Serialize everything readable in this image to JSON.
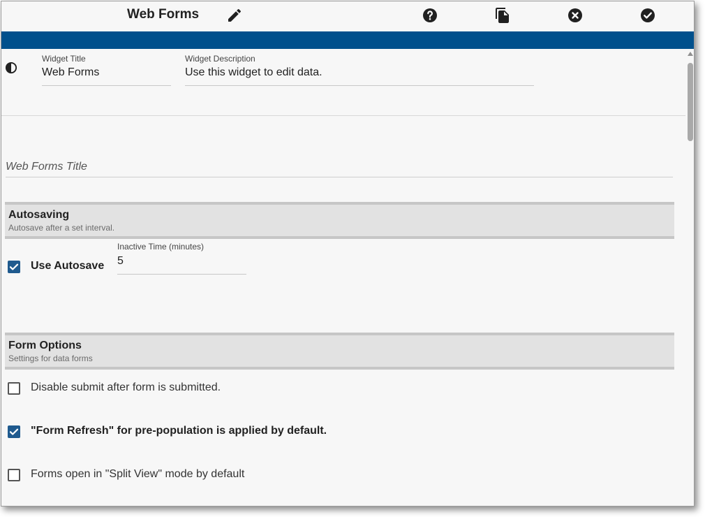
{
  "header": {
    "title": "Web Forms",
    "icons": [
      "pencil-icon",
      "help-icon",
      "copy-icon",
      "cancel-icon",
      "confirm-icon"
    ],
    "accent_color": "#00508c"
  },
  "widget": {
    "title_label": "Widget Title",
    "title_value": "Web Forms",
    "description_label": "Widget Description",
    "description_value": "Use this widget to edit data."
  },
  "web_forms_title": {
    "placeholder": "Web Forms Title"
  },
  "autosaving": {
    "title": "Autosaving",
    "subtitle": "Autosave after a set interval.",
    "use_autosave_label": "Use Autosave",
    "use_autosave_checked": true,
    "inactive_time_label": "Inactive Time (minutes)",
    "inactive_time_value": "5"
  },
  "form_options": {
    "title": "Form Options",
    "subtitle": "Settings for data forms",
    "options": [
      {
        "label": "Disable submit after form is submitted.",
        "checked": false
      },
      {
        "label": "\"Form Refresh\" for pre-population is applied by default.",
        "checked": true
      },
      {
        "label": "Forms open in \"Split View\" mode by default",
        "checked": false
      }
    ]
  }
}
